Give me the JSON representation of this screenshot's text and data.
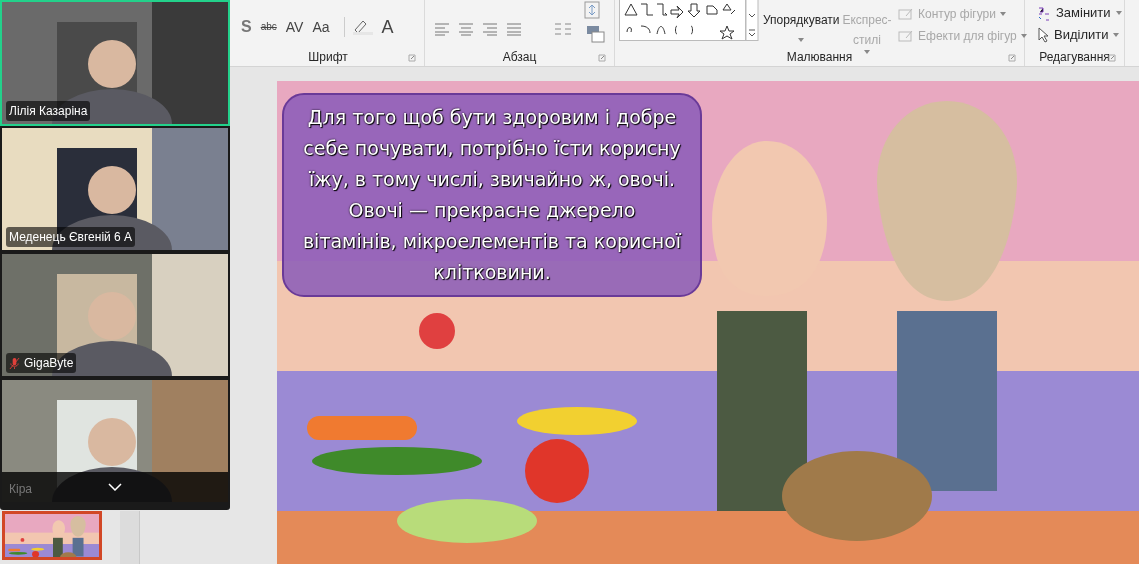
{
  "ribbon": {
    "font_tools": [
      "S",
      "abc",
      "AV",
      "Aa",
      "A"
    ],
    "drawing_buttons": [
      {
        "label": "Упорядкувати",
        "disabled": false
      },
      {
        "label": "Експрес- стилі",
        "disabled": true
      }
    ],
    "shape_format": [
      {
        "label": "Контур фігури",
        "disabled": true
      },
      {
        "label": "Ефекти для фігур",
        "disabled": true
      }
    ],
    "editing": [
      {
        "label": "Замінити"
      },
      {
        "label": "Виділити"
      }
    ],
    "groups": [
      {
        "label": "Шрифт"
      },
      {
        "label": "Абзац"
      },
      {
        "label": "Малювання"
      },
      {
        "label": "Редагування"
      }
    ]
  },
  "participants": [
    {
      "name": "Лілія Казаріна",
      "speaking": true,
      "muted": false
    },
    {
      "name": "Меденець Євгеній 6 А",
      "speaking": false,
      "muted": false
    },
    {
      "name": "GigaByte",
      "speaking": false,
      "muted": true
    },
    {
      "name": "Кіра",
      "speaking": false,
      "muted": false
    }
  ],
  "slide": {
    "text": "Для того щоб бути здоровим і добре себе почувати, потрібно їсти корисну їжу, в тому числі, звичайно ж, овочі. Овочі — прекрасне джерело вітамінів, мікроелементів та корисної клітковини.",
    "thumbnail_selected": true
  }
}
